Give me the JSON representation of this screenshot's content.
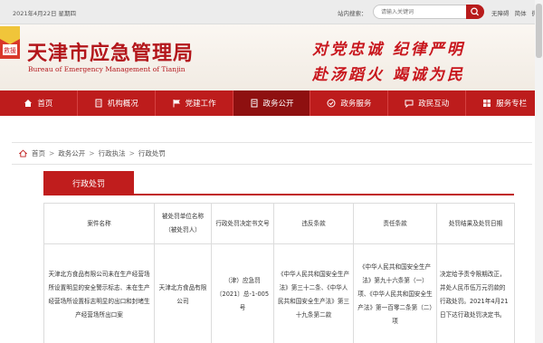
{
  "topbar": {
    "date": "2021年4月22日 星期四",
    "search_label": "站内搜索：",
    "search_placeholder": "请输入关键词",
    "links": [
      "无障碍",
      "简体",
      "微博"
    ]
  },
  "header": {
    "title": "天津市应急管理局",
    "subtitle": "Bureau of Emergency Management of Tianjin",
    "slogan_line1": "对党忠诚 纪律严明",
    "slogan_line2": "赴汤蹈火 竭诚为民",
    "emblem_text": "救援"
  },
  "nav": {
    "items": [
      {
        "label": "首页",
        "icon": "home-icon"
      },
      {
        "label": "机构概况",
        "icon": "building-icon"
      },
      {
        "label": "党建工作",
        "icon": "flag-icon"
      },
      {
        "label": "政务公开",
        "icon": "document-icon"
      },
      {
        "label": "政务服务",
        "icon": "service-icon"
      },
      {
        "label": "政民互动",
        "icon": "chat-icon"
      },
      {
        "label": "服务专栏",
        "icon": "column-icon"
      }
    ],
    "active_index": 3
  },
  "breadcrumb": [
    "首页",
    "政务公开",
    "行政执法",
    "行政处罚"
  ],
  "tab": {
    "label": "行政处罚"
  },
  "table": {
    "headers": [
      "案件名称",
      "被处罚单位名称（被处罚人）",
      "行政处罚决定书文号",
      "违反条款",
      "责任条款",
      "处罚结果及处罚日期"
    ],
    "rows": [
      [
        "天津北方食品有限公司未在生产经营场所设置明显的安全警示标志、未在生产经营场所设置标志明显的出口和封堵生产经营场所出口案",
        "天津北方食品有限公司",
        "（津）应急罚〔2021〕总-1-005号",
        "《中华人民共和国安全生产法》第三十二条、《中华人民共和国安全生产法》第三十九条第二款",
        "《中华人民共和国安全生产法》第九十六条第（一）项、《中华人民共和国安全生产法》第一百零二条第（二）项",
        "决定给予责令限期改正，并处人民币伍万元罚款的行政处罚。2021年4月21日下达行政处罚决定书。"
      ]
    ]
  },
  "colors": {
    "brand_red": "#bd1c1c",
    "active_nav": "#8e1010"
  }
}
